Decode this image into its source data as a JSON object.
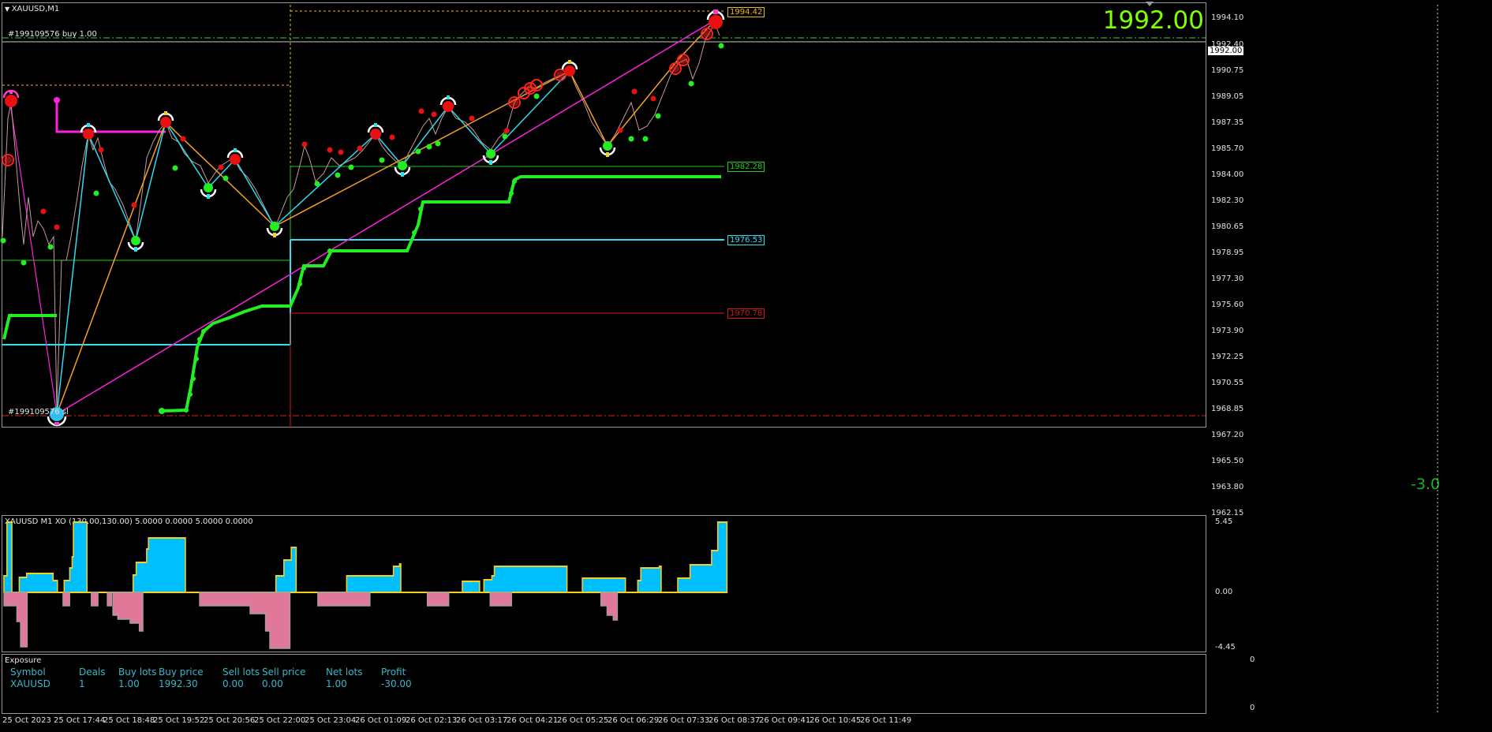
{
  "window": {
    "title": "XAUUSD,M1"
  },
  "price": {
    "current": "1992.00",
    "pnl_label": "-3.0"
  },
  "orders": {
    "buy_label": "#199109576 buy 1.00",
    "sl_label": "#199109576 sl"
  },
  "levels": {
    "top": "1994.42",
    "green": "1982.28",
    "cyan": "1976.53",
    "red": "1970.78",
    "current_tag": "1992.00"
  },
  "price_axis": [
    "1994.10",
    "1992.40",
    "1990.75",
    "1989.05",
    "1987.35",
    "1985.70",
    "1984.00",
    "1982.30",
    "1980.65",
    "1978.95",
    "1977.30",
    "1975.60",
    "1973.90",
    "1972.25",
    "1970.55",
    "1968.85",
    "1967.20",
    "1965.50",
    "1963.80",
    "1962.15"
  ],
  "indicator": {
    "title": "XAUUSD M1 XO (130.00,130.00) 5.0000 0.0000 5.0000 0.0000",
    "axis": [
      "5.45",
      "0.00",
      "-4.45"
    ]
  },
  "exposure": {
    "title": "Exposure",
    "axis": [
      "0",
      "0"
    ],
    "headers": [
      "Symbol",
      "Deals",
      "Buy lots",
      "Buy price",
      "Sell lots",
      "Sell price",
      "Net lots",
      "Profit"
    ],
    "row": [
      "XAUUSD",
      "1",
      "1.00",
      "1992.30",
      "0.00",
      "0.00",
      "1.00",
      "-30.00"
    ]
  },
  "time_axis": [
    "25 Oct 2023",
    "25 Oct 17:44",
    "25 Oct 18:48",
    "25 Oct 19:52",
    "25 Oct 20:56",
    "25 Oct 22:00",
    "25 Oct 23:04",
    "26 Oct 01:09",
    "26 Oct 02:13",
    "26 Oct 03:17",
    "26 Oct 04:21",
    "26 Oct 05:25",
    "26 Oct 06:29",
    "26 Oct 07:33",
    "26 Oct 08:37",
    "26 Oct 09:41",
    "26 Oct 10:45",
    "26 Oct 11:49"
  ],
  "colors": {
    "background": "#000000",
    "price_green": "#7fff00",
    "level_green": "#1ecb1e",
    "level_cyan": "#30e0f0",
    "level_red": "#d01818",
    "level_top": "#e8b820",
    "histogram_pos": "#00bfff",
    "histogram_neg": "#e0789a",
    "exposure_text": "#35b9c9"
  }
}
